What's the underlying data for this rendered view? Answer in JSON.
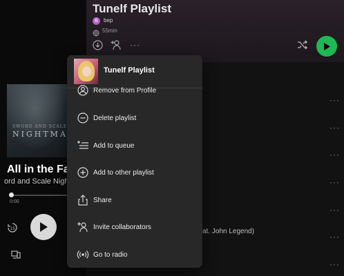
{
  "playlist": {
    "title": "Tunelf Playlist",
    "owner_initial": "B",
    "owner": "bep",
    "duration": "55min"
  },
  "now_playing": {
    "title": "All in the Fam",
    "artist": "ord and Scale Nigh",
    "elapsed": "0:00",
    "album_text_small": "SWORD AND SCALE",
    "album_text_big": "NIGHTMAR"
  },
  "tracks": {
    "partial_label": "at. John Legend)"
  },
  "menu": {
    "title": "Tunelf Playlist",
    "items": [
      {
        "label": "Remove from Profile",
        "icon": "remove-profile-icon"
      },
      {
        "label": "Delete playlist",
        "icon": "delete-icon"
      },
      {
        "label": "Add to queue",
        "icon": "queue-icon"
      },
      {
        "label": "Add to other playlist",
        "icon": "add-playlist-icon"
      },
      {
        "label": "Share",
        "icon": "share-icon"
      },
      {
        "label": "Invite collaborators",
        "icon": "invite-icon"
      },
      {
        "label": "Go to radio",
        "icon": "radio-icon"
      }
    ]
  },
  "colors": {
    "accent_green": "#1db954",
    "menu_bg": "#282828",
    "header_tint": "#2a2029"
  }
}
